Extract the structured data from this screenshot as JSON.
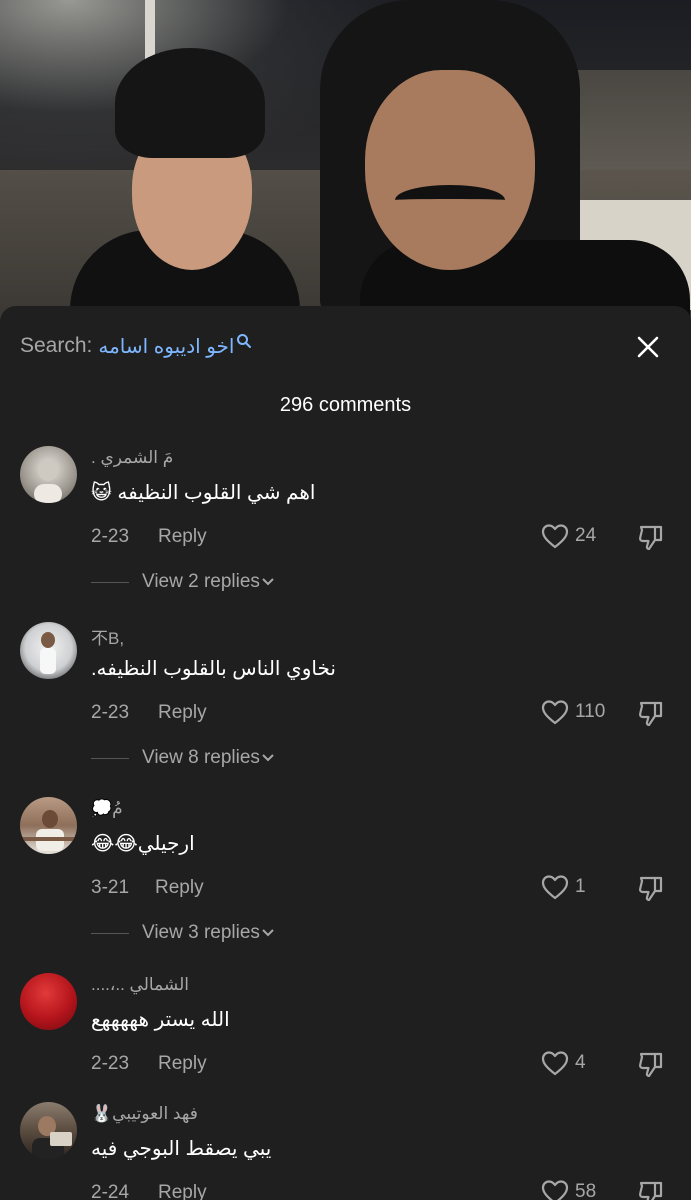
{
  "search": {
    "prefix": "Search:",
    "query": "اخو اديبوه اسامه"
  },
  "comments_count": "296 comments",
  "comments": [
    {
      "username": "مَ الشمري .",
      "text": "اهم شي القلوب النظيفه 😺",
      "date": "2-23",
      "reply_label": "Reply",
      "likes": "24",
      "view_replies": "View 2 replies"
    },
    {
      "username": "不B,",
      "text": "نخاوي الناس بالقلوب النظيفه.",
      "date": "2-23",
      "reply_label": "Reply",
      "likes": "110",
      "view_replies": "View 8 replies"
    },
    {
      "username": "مُ💭",
      "text": "ارجيلي😂😂",
      "date": "3-21",
      "reply_label": "Reply",
      "likes": "1",
      "view_replies": "View 3 replies"
    },
    {
      "username": "الشمالي ..،....",
      "text": "الله يستر هههههع",
      "date": "2-23",
      "reply_label": "Reply",
      "likes": "4",
      "view_replies": ""
    },
    {
      "username": "فهد العوتيبي🐰",
      "text": "يبي يصقط البوجي فيه",
      "date": "2-24",
      "reply_label": "Reply",
      "likes": "58",
      "view_replies": ""
    }
  ],
  "icons": {
    "search": "search-icon",
    "close": "close-icon",
    "like": "heart-icon",
    "dislike": "thumbs-down-icon",
    "chevron": "chevron-down-icon"
  },
  "colors": {
    "background": "#1f1f1f",
    "search_query": "#7eb7ff",
    "secondary_text": "#a7a7a7"
  }
}
